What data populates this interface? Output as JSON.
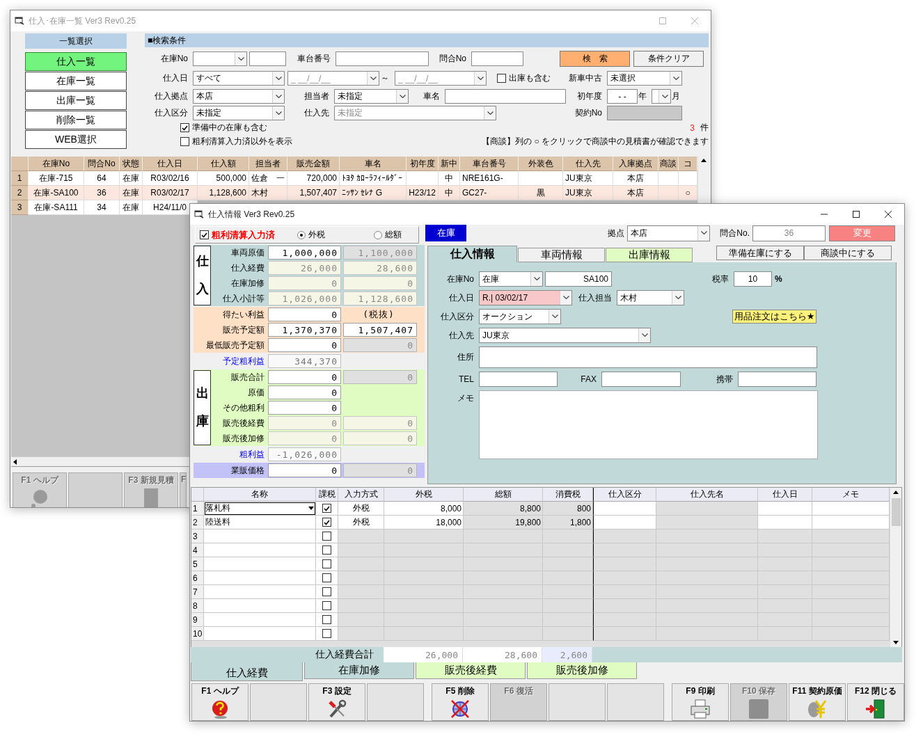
{
  "back_window": {
    "title": "仕入･在庫一覧 Ver3 Rev0.25",
    "nav": {
      "header": "一覧選択",
      "items": [
        {
          "label": "仕入一覧",
          "selected": true
        },
        {
          "label": "在庫一覧",
          "selected": false
        },
        {
          "label": "出庫一覧",
          "selected": false
        },
        {
          "label": "削除一覧",
          "selected": false
        },
        {
          "label": "WEB選択",
          "selected": false
        }
      ]
    },
    "search": {
      "header": "■検索条件",
      "stock_no": {
        "label": "在庫No"
      },
      "chassis_no": {
        "label": "車台番号"
      },
      "inquiry_no": {
        "label": "問合No"
      },
      "search_button": "検　索",
      "clear_button": "条件クリア",
      "purchase_date": {
        "label": "仕入日",
        "value": "すべて",
        "from": "_ __/__/__",
        "separator": "～",
        "to": "_ __/__/__"
      },
      "include_shipped": {
        "label": "出庫も含む",
        "checked": false
      },
      "new_used": {
        "label": "新車中古",
        "value": "未選択"
      },
      "branch": {
        "label": "仕入拠点",
        "value": "本店"
      },
      "staff": {
        "label": "担当者",
        "value": "未指定"
      },
      "car_name": {
        "label": "車名"
      },
      "first_year": {
        "label": "初年度",
        "value": "- -",
        "year_unit": "年",
        "month_unit": "月"
      },
      "purchase_type": {
        "label": "仕入区分",
        "value": "未指定"
      },
      "supplier": {
        "label": "仕入先",
        "value": "未指定",
        "disabled": true
      },
      "contract_no": {
        "label": "契約No"
      },
      "options": [
        {
          "label": "準備中の在庫も含む",
          "checked": true
        },
        {
          "label": "粗利清算入力済以外を表示",
          "checked": false
        }
      ],
      "count": "3",
      "count_unit": "件",
      "note": "【商談】列の ○ をクリックで商談中の見積書が確認できます"
    },
    "table": {
      "columns": [
        "在庫No",
        "問合No",
        "状態",
        "仕入日",
        "仕入額",
        "担当者",
        "販売金額",
        "車名",
        "初年度",
        "新中",
        "車台番号",
        "外装色",
        "仕入先",
        "入庫拠点",
        "商談",
        "コ"
      ],
      "rows": [
        {
          "number": "1",
          "selected": false,
          "cells": [
            "在庫-715",
            "64",
            "在庫",
            "R03/02/16",
            "500,000",
            "佐倉　一",
            "720,000",
            "ﾄﾖﾀ ｶﾛｰﾗﾌｨｰﾙﾀﾞｰ",
            null,
            "中",
            "NRE161G-",
            null,
            "JU東京",
            "本店",
            null,
            null
          ]
        },
        {
          "number": "2",
          "selected": true,
          "cells": [
            "在庫-SA100",
            "36",
            "在庫",
            "R03/02/17",
            "1,128,600",
            "木村",
            "1,507,407",
            "ﾆｯｻﾝ ｾﾚﾅ G",
            "H23/12",
            "中",
            "GC27-",
            "黒",
            "JU東京",
            "本店",
            null,
            "○"
          ]
        },
        {
          "number": "3",
          "selected": false,
          "cells": [
            "在庫-SA111",
            "34",
            "在庫",
            "H24/11/0"
          ]
        }
      ]
    },
    "function_keys": [
      {
        "kind": "key",
        "label": "F1 ヘルプ",
        "disabled": true
      },
      {
        "kind": "blank"
      },
      {
        "kind": "key",
        "label": "F3 新規見積",
        "disabled": true
      },
      {
        "kind": "key",
        "label": "F",
        "disabled": true
      }
    ]
  },
  "front_window": {
    "title": "仕入情報 Ver3 Rev0.25",
    "cost_panel": {
      "settled": {
        "label": "粗利清算入力済",
        "checked": true
      },
      "tax_modes": [
        {
          "label": "外税",
          "selected": true
        },
        {
          "label": "総額",
          "selected": false
        }
      ],
      "sections": [
        {
          "side_label": "仕入",
          "color": "#c2d9d9",
          "rows": [
            {
              "label": "車両原価",
              "linked": false,
              "cells": [
                {
                  "value": "1,000,000",
                  "kind": "input"
                },
                {
                  "value": "1,100,000",
                  "kind": "disabled"
                }
              ]
            },
            {
              "label": "仕入経費",
              "linked": false,
              "cells": [
                {
                  "value": "26,000",
                  "kind": "readonly"
                },
                {
                  "value": "28,600",
                  "kind": "readonly"
                }
              ]
            },
            {
              "label": "在庫加修",
              "linked": false,
              "cells": [
                {
                  "value": "0",
                  "kind": "readonly"
                },
                {
                  "value": "0",
                  "kind": "readonly"
                }
              ]
            },
            {
              "label": "仕入小計等",
              "linked": false,
              "cells": [
                {
                  "value": "1,026,000",
                  "kind": "readonly"
                },
                {
                  "value": "1,128,600",
                  "kind": "readonly"
                }
              ]
            }
          ]
        },
        {
          "color": "#fde0c6",
          "rows": [
            {
              "label": "得たい利益",
              "linked": false,
              "cells": [
                {
                  "value": "0",
                  "kind": "input"
                },
                {
                  "value": "(税抜)",
                  "kind": "note"
                }
              ]
            },
            {
              "label": "販売予定額",
              "linked": false,
              "cells": [
                {
                  "value": "1,370,370",
                  "kind": "input"
                },
                {
                  "value": "1,507,407",
                  "kind": "input"
                }
              ]
            },
            {
              "label": "最低販売予定額",
              "linked": false,
              "cells": [
                {
                  "value": "0",
                  "kind": "input"
                },
                {
                  "value": "0",
                  "kind": "disabled"
                }
              ]
            }
          ]
        },
        {
          "rows": [
            {
              "label": "予定粗利益",
              "linked": true,
              "cells": [
                {
                  "value": "344,370",
                  "kind": "display"
                }
              ]
            }
          ]
        },
        {
          "side_label": "出庫",
          "color": "#e0fcc2",
          "rows": [
            {
              "label": "販売合計",
              "linked": false,
              "cells": [
                {
                  "value": "0",
                  "kind": "input"
                },
                {
                  "value": "0",
                  "kind": "disabled"
                }
              ]
            },
            {
              "label": "原価",
              "linked": false,
              "cells": [
                {
                  "value": "0",
                  "kind": "input"
                }
              ]
            },
            {
              "label": "その他粗利",
              "linked": false,
              "cells": [
                {
                  "value": "0",
                  "kind": "input"
                }
              ]
            },
            {
              "label": "販売後経費",
              "linked": false,
              "cells": [
                {
                  "value": "0",
                  "kind": "readonly"
                },
                {
                  "value": "0",
                  "kind": "readonly"
                }
              ]
            },
            {
              "label": "販売後加修",
              "linked": false,
              "cells": [
                {
                  "value": "0",
                  "kind": "readonly"
                },
                {
                  "value": "0",
                  "kind": "readonly"
                }
              ]
            }
          ]
        },
        {
          "rows": [
            {
              "label": "粗利益",
              "linked": true,
              "cells": [
                {
                  "value": "-1,026,000",
                  "kind": "display"
                }
              ]
            }
          ]
        },
        {
          "color": "#c2c2f8",
          "rows": [
            {
              "label": "業販価格",
              "linked": false,
              "cells": [
                {
                  "value": "0",
                  "kind": "input"
                },
                {
                  "value": "0",
                  "kind": "disabled"
                }
              ]
            }
          ]
        }
      ]
    },
    "header": {
      "status": "在庫",
      "branch": {
        "label": "拠点",
        "value": "本店"
      },
      "inquiry": {
        "label": "問合No.",
        "value": "36"
      },
      "change_button": "変更"
    },
    "tabs": [
      {
        "label": "仕入情報",
        "selected": true,
        "color": "#c2d9d9"
      },
      {
        "label": "車両情報",
        "selected": false,
        "color": "#f0f0f0"
      },
      {
        "label": "出庫情報",
        "selected": false,
        "color": "#e0fcc2"
      }
    ],
    "actions": [
      "準備在庫にする",
      "商談中にする"
    ],
    "purchase_info": {
      "stock_no": {
        "label": "在庫No",
        "prefix": "在庫",
        "number": "SA100"
      },
      "tax_rate": {
        "label": "税率",
        "value": "10",
        "unit": "%"
      },
      "purchase_date": {
        "label": "仕入日",
        "value": "R.| 03/02/17",
        "highlighted": true
      },
      "buyer": {
        "label": "仕入担当",
        "value": "木村"
      },
      "purchase_type": {
        "label": "仕入区分",
        "value": "オークション"
      },
      "order_button": "用品注文はこちら★",
      "supplier": {
        "label": "仕入先",
        "value": "JU東京"
      },
      "address": {
        "label": "住所"
      },
      "tel": {
        "label": "TEL"
      },
      "fax": {
        "label": "FAX"
      },
      "mobile": {
        "label": "携帯"
      },
      "memo": {
        "label": "メモ"
      }
    },
    "expenses": {
      "columns": [
        "名称",
        "課税",
        "入力方式",
        "外税",
        "総額",
        "消費税",
        "仕入区分",
        "仕入先名",
        "仕入日",
        "メモ"
      ],
      "rows": [
        {
          "number": "1",
          "active": true,
          "taxable": true,
          "name": "落札料",
          "input_mode": "外税",
          "tax_excluded": "8,000",
          "total": "8,800",
          "tax": "800"
        },
        {
          "number": "2",
          "active": false,
          "taxable": true,
          "name": "陸送料",
          "input_mode": "外税",
          "tax_excluded": "18,000",
          "total": "19,800",
          "tax": "1,800"
        },
        {
          "number": "3",
          "active": false,
          "taxable": false
        },
        {
          "number": "4",
          "active": false,
          "taxable": false
        },
        {
          "number": "5",
          "active": false,
          "taxable": false
        },
        {
          "number": "6",
          "active": false,
          "taxable": false
        },
        {
          "number": "7",
          "active": false,
          "taxable": false
        },
        {
          "number": "8",
          "active": false,
          "taxable": false
        },
        {
          "number": "9",
          "active": false,
          "taxable": false
        },
        {
          "number": "10",
          "active": false,
          "taxable": false
        }
      ],
      "totals": {
        "label": "仕入経費合計",
        "tax_excluded": "26,000",
        "total": "28,600",
        "tax": "2,600"
      }
    },
    "bottom_tabs": [
      {
        "label": "仕入経費",
        "selected": true,
        "color": "#c2d9d9"
      },
      {
        "label": "在庫加修",
        "selected": false,
        "color": "#c2d9d9"
      },
      {
        "label": "販売後経費",
        "selected": false,
        "color": "#e0fcc2"
      },
      {
        "label": "販売後加修",
        "selected": false,
        "color": "#e0fcc2"
      }
    ],
    "function_keys": [
      {
        "kind": "key",
        "label": "F1 ヘルプ",
        "disabled": false
      },
      {
        "kind": "blank"
      },
      {
        "kind": "key",
        "label": "F3 設定",
        "disabled": false
      },
      {
        "kind": "blank"
      },
      {
        "kind": "key",
        "label": "F5 削除",
        "disabled": false
      },
      {
        "kind": "key",
        "label": "F6 復活",
        "disabled": true
      },
      {
        "kind": "blank"
      },
      {
        "kind": "blank"
      },
      {
        "kind": "key",
        "label": "F9 印刷",
        "disabled": false
      },
      {
        "kind": "key",
        "label": "F10 保存",
        "disabled": true
      },
      {
        "kind": "key",
        "label": "F11 契約原価",
        "disabled": false
      },
      {
        "kind": "key",
        "label": "F12 閉じる",
        "disabled": false
      }
    ]
  }
}
